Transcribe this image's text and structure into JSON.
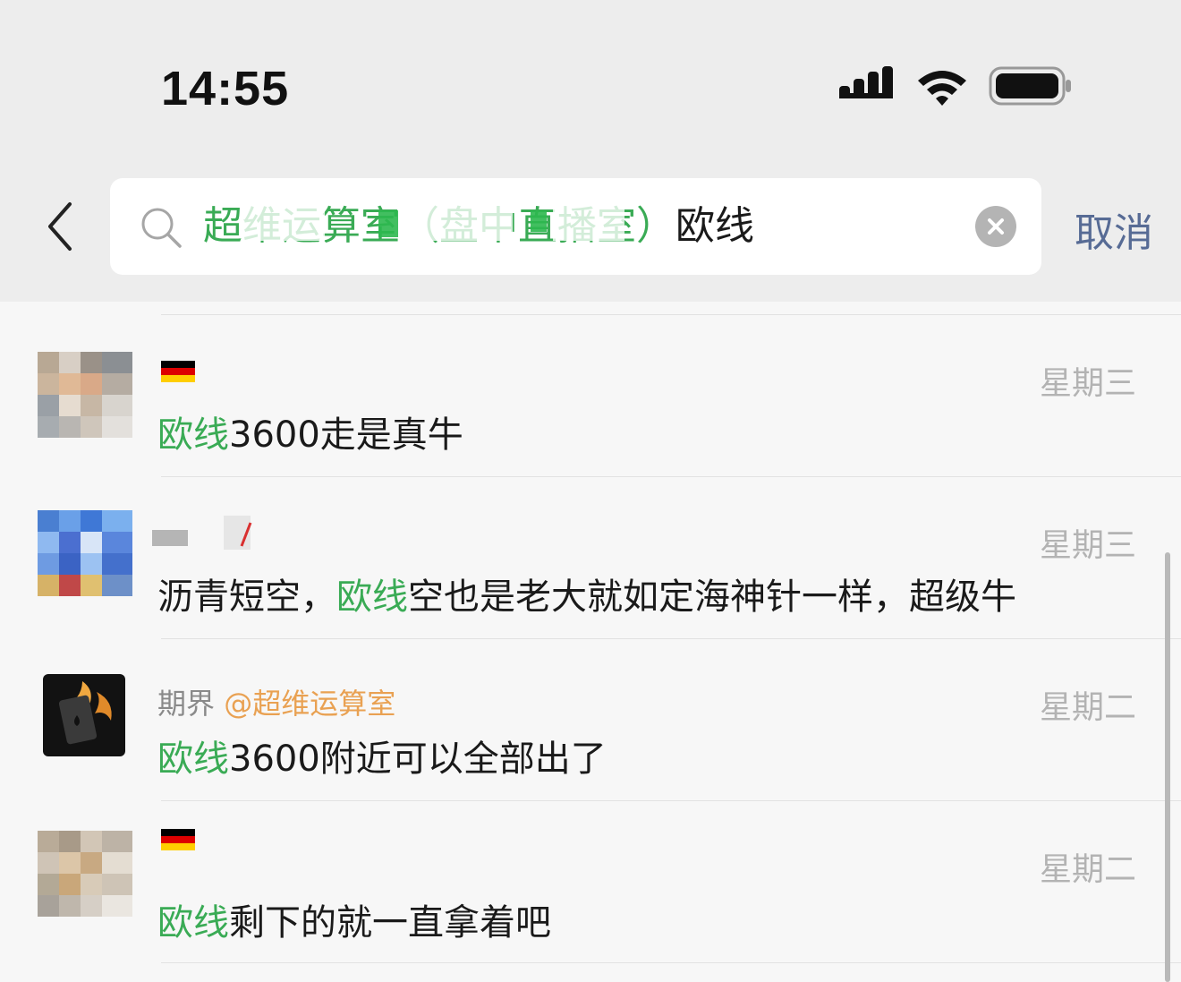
{
  "status_bar": {
    "time": "14:55",
    "icons": [
      "signal-icon",
      "wifi-icon",
      "battery-icon"
    ]
  },
  "search": {
    "query_group": "超维运算室（盘中直播室）",
    "query_term": "欧线",
    "clear_icon": "clear-icon",
    "cancel_label": "取消"
  },
  "results": [
    {
      "name": "",
      "mention": "",
      "date": "星期三",
      "message_highlight": "欧线",
      "message_rest": "3600走是真牛"
    },
    {
      "name": "",
      "mention": "",
      "date": "星期三",
      "message_prefix": "沥青短空，",
      "message_highlight": "欧线",
      "message_rest": "空也是老大就如定海神针一样，超级牛"
    },
    {
      "name": "期界",
      "mention": "@超维运算室",
      "date": "星期二",
      "message_highlight": "欧线",
      "message_rest": "3600附近可以全部出了"
    },
    {
      "name": "",
      "mention": "",
      "date": "星期二",
      "message_highlight": "欧线",
      "message_rest": "剩下的就一直拿着吧"
    }
  ],
  "colors": {
    "highlight": "#3aab55",
    "mention": "#e9a152",
    "cancel": "#576b95",
    "date": "#b3b3b3"
  }
}
